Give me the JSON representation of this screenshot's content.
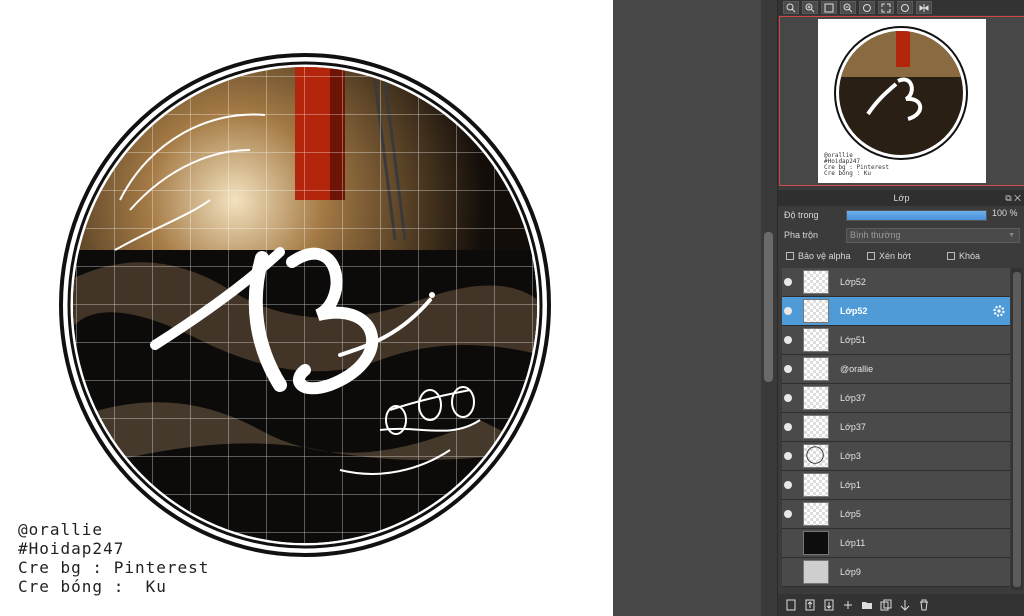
{
  "canvas": {
    "credits": [
      "@orallie",
      "#Hoidap247",
      "Cre bg : Pinterest",
      "Cre bóng :  Ku"
    ]
  },
  "navigator": {
    "credits": [
      "@orallie",
      "#Hoidap247",
      "Cre bg : Pinterest",
      "Cre bóng : Ku"
    ],
    "toolbar_icons": [
      "zoom-in-icon",
      "zoom-in-icon",
      "fit-icon",
      "zoom-out-icon",
      "rotate-left-icon",
      "fullscreen-icon",
      "rotate-right-icon",
      "flip-icon"
    ]
  },
  "layer_panel": {
    "title": "Lớp",
    "opacity_label": "Độ trong",
    "opacity_value": "100 %",
    "opacity_fraction": 1.0,
    "blend_label": "Pha trộn",
    "blend_value": "Bình thường",
    "checkbox_alpha": "Bảo vệ alpha",
    "checkbox_clip": "Xén bớt",
    "checkbox_lock": "Khóa",
    "layers": [
      {
        "name": "Lớp52",
        "visible": true,
        "thumb": "checker",
        "selected": false
      },
      {
        "name": "Lớp52",
        "visible": true,
        "thumb": "checker",
        "selected": true
      },
      {
        "name": "Lớp51",
        "visible": true,
        "thumb": "checker",
        "selected": false
      },
      {
        "name": "@orallie",
        "visible": true,
        "thumb": "checker",
        "selected": false
      },
      {
        "name": "Lớp37",
        "visible": true,
        "thumb": "checker",
        "selected": false
      },
      {
        "name": "Lớp37",
        "visible": true,
        "thumb": "checker",
        "selected": false
      },
      {
        "name": "Lớp3",
        "visible": true,
        "thumb": "circle",
        "selected": false
      },
      {
        "name": "Lớp1",
        "visible": true,
        "thumb": "checker",
        "selected": false
      },
      {
        "name": "Lớp5",
        "visible": true,
        "thumb": "checker",
        "selected": false
      },
      {
        "name": "Lớp11",
        "visible": false,
        "thumb": "dark",
        "selected": false
      },
      {
        "name": "Lớp9",
        "visible": false,
        "thumb": "gray",
        "selected": false
      }
    ]
  },
  "colors": {
    "selected_row": "#4f9bd8",
    "navigator_border": "#d24747",
    "panel_bg": "#3b3b3b"
  }
}
